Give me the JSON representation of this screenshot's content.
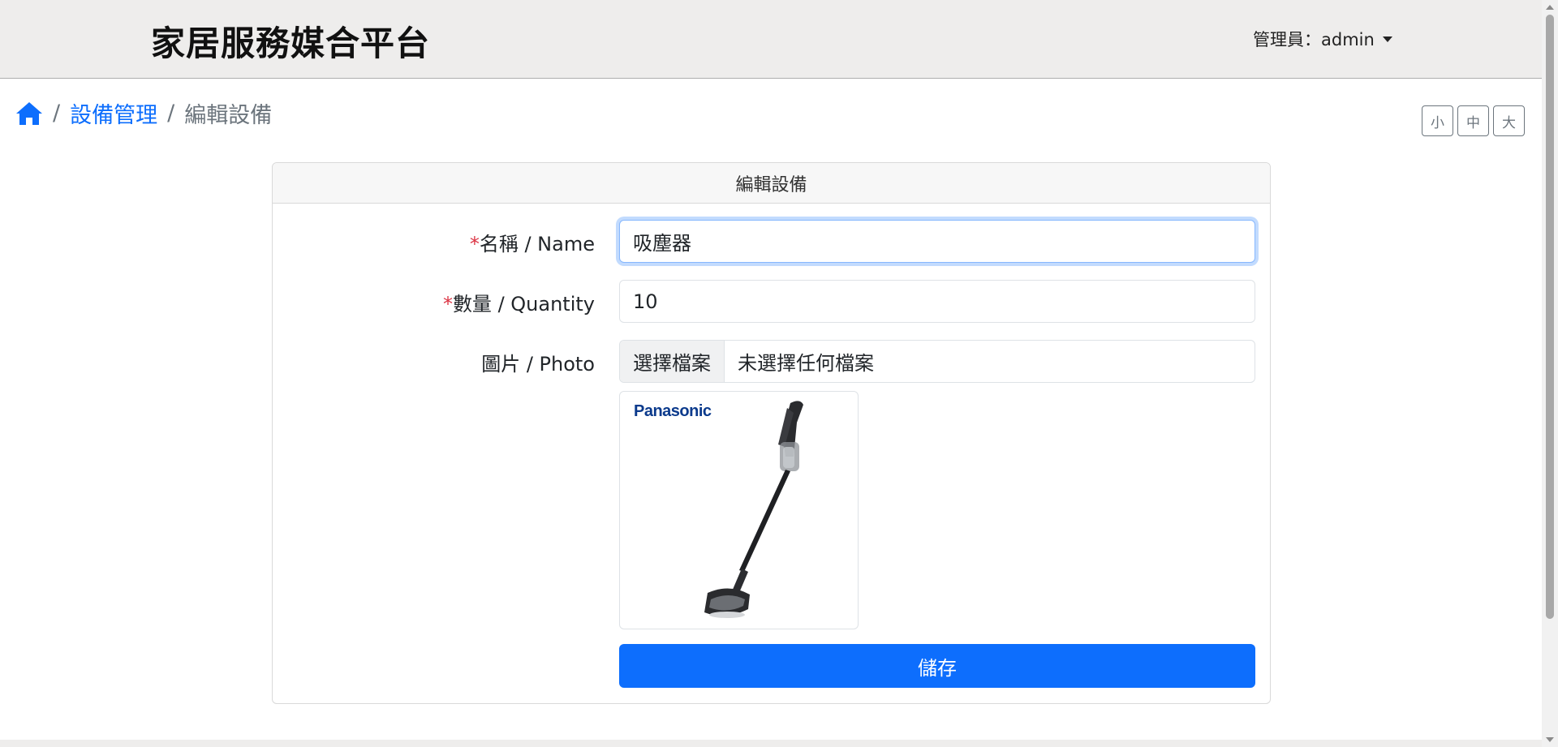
{
  "navbar": {
    "brand": "家居服務媒合平台",
    "admin_label": "管理員：admin"
  },
  "breadcrumb": {
    "home_icon": "home-icon",
    "parent": "設備管理",
    "current": "編輯設備"
  },
  "font_size_buttons": [
    "小",
    "中",
    "大"
  ],
  "form": {
    "header": "編輯設備",
    "name_label": "名稱 / Name",
    "name_value": "吸塵器",
    "quantity_label": "數量 / Quantity",
    "quantity_value": "10",
    "photo_label": "圖片 / Photo",
    "file_button": "選擇檔案",
    "file_status": "未選擇任何檔案",
    "image_brand": "Panasonic",
    "save_button": "儲存"
  },
  "colors": {
    "primary": "#0d6efd",
    "required": "#dc3545",
    "navbar_bg": "#eeedec"
  }
}
